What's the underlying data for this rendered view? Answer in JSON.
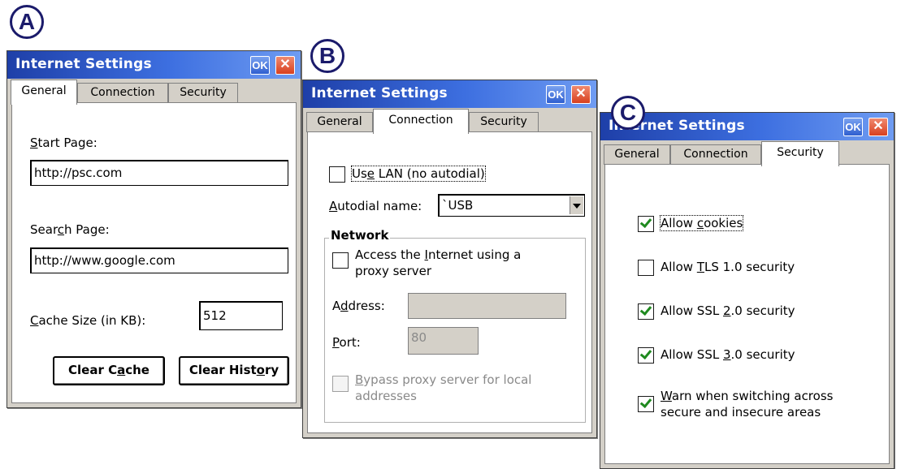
{
  "badges": {
    "a": "A",
    "b": "B",
    "c": "C"
  },
  "window_a": {
    "title": "Internet Settings",
    "ok": "OK",
    "close": "✕",
    "tabs": [
      "General",
      "Connection",
      "Security"
    ],
    "active_tab": "General",
    "start_page": {
      "l1": "S",
      "l2": "tart Page:",
      "value": "http://psc.com"
    },
    "search_page": {
      "l1": "Sear",
      "l2": "c",
      "l3": "h Page:",
      "value": "http://www.google.com"
    },
    "cache": {
      "l1": "C",
      "l2": "ache Size (in KB):",
      "value": "512"
    },
    "clear_cache": {
      "l1": "Clear C",
      "l2": "a",
      "l3": "che"
    },
    "clear_history": {
      "l1": "Clear Hist",
      "l2": "o",
      "l3": "ry"
    }
  },
  "window_b": {
    "title": "Internet Settings",
    "ok": "OK",
    "close": "✕",
    "tabs": [
      "General",
      "Connection",
      "Security"
    ],
    "active_tab": "Connection",
    "use_lan": {
      "l1": "Us",
      "l2": "e",
      "l3": " LAN (no autodial)",
      "checked": false
    },
    "autodial": {
      "l1": "A",
      "l2": "utodial name:",
      "value": "`USB"
    },
    "network_title": "Network",
    "proxy": {
      "line1a": "Access the ",
      "line1b": "I",
      "line1c": "nternet using a",
      "line2": "proxy server",
      "checked": false
    },
    "address": {
      "l1": "A",
      "l2": "d",
      "l3": "dress:",
      "value": ""
    },
    "port": {
      "l1": "P",
      "l2": "ort:",
      "value": "80"
    },
    "bypass": {
      "line1a": "B",
      "line1b": "ypass proxy server for local",
      "line2": "addresses",
      "checked": false
    }
  },
  "window_c": {
    "title": "Internet Settings",
    "ok": "OK",
    "close": "✕",
    "tabs": [
      "General",
      "Connection",
      "Security"
    ],
    "active_tab": "Security",
    "cookies": {
      "l1": "Allow ",
      "l2": "c",
      "l3": "ookies",
      "checked": true
    },
    "tls": {
      "l1": "Allow ",
      "l2": "T",
      "l3": "LS 1.0 security",
      "checked": false
    },
    "ssl2": {
      "l1": "Allow SSL ",
      "l2": "2",
      "l3": ".0 security",
      "checked": true
    },
    "ssl3": {
      "l1": "Allow SSL ",
      "l2": "3",
      "l3": ".0 security",
      "checked": true
    },
    "warn": {
      "line1a": "W",
      "line1b": "arn when switching across",
      "line2": "secure and insecure areas",
      "checked": true
    }
  }
}
